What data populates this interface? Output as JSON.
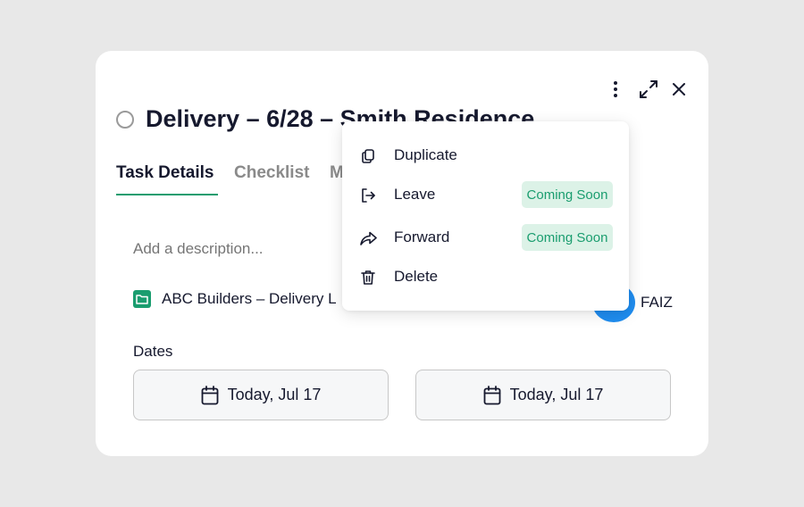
{
  "task": {
    "title": "Delivery – 6/28 – Smith Residence",
    "description_placeholder": "Add a description...",
    "project": "ABC Builders – Delivery L",
    "assignee": "FAIZ",
    "dates_label": "Dates",
    "start_date": "Today, Jul 17",
    "end_date": "Today, Jul 17"
  },
  "tabs": [
    {
      "label": "Task Details"
    },
    {
      "label": "Checklist"
    },
    {
      "label": "M"
    }
  ],
  "header_icons": [
    "more-vertical-icon",
    "expand-icon",
    "close-icon"
  ],
  "menu": {
    "items": [
      {
        "label": "Duplicate",
        "icon": "copy-icon"
      },
      {
        "label": "Leave",
        "icon": "exit-icon",
        "badge": "Coming Soon"
      },
      {
        "label": "Forward",
        "icon": "forward-arrow-icon",
        "badge": "Coming Soon"
      },
      {
        "label": "Delete",
        "icon": "trash-icon"
      }
    ]
  },
  "colors": {
    "accent": "#1a9d6f",
    "badge_bg": "#dcf2e7",
    "avatar": "#1f8df0",
    "text": "#16192e",
    "background": "#e8e8e8"
  }
}
